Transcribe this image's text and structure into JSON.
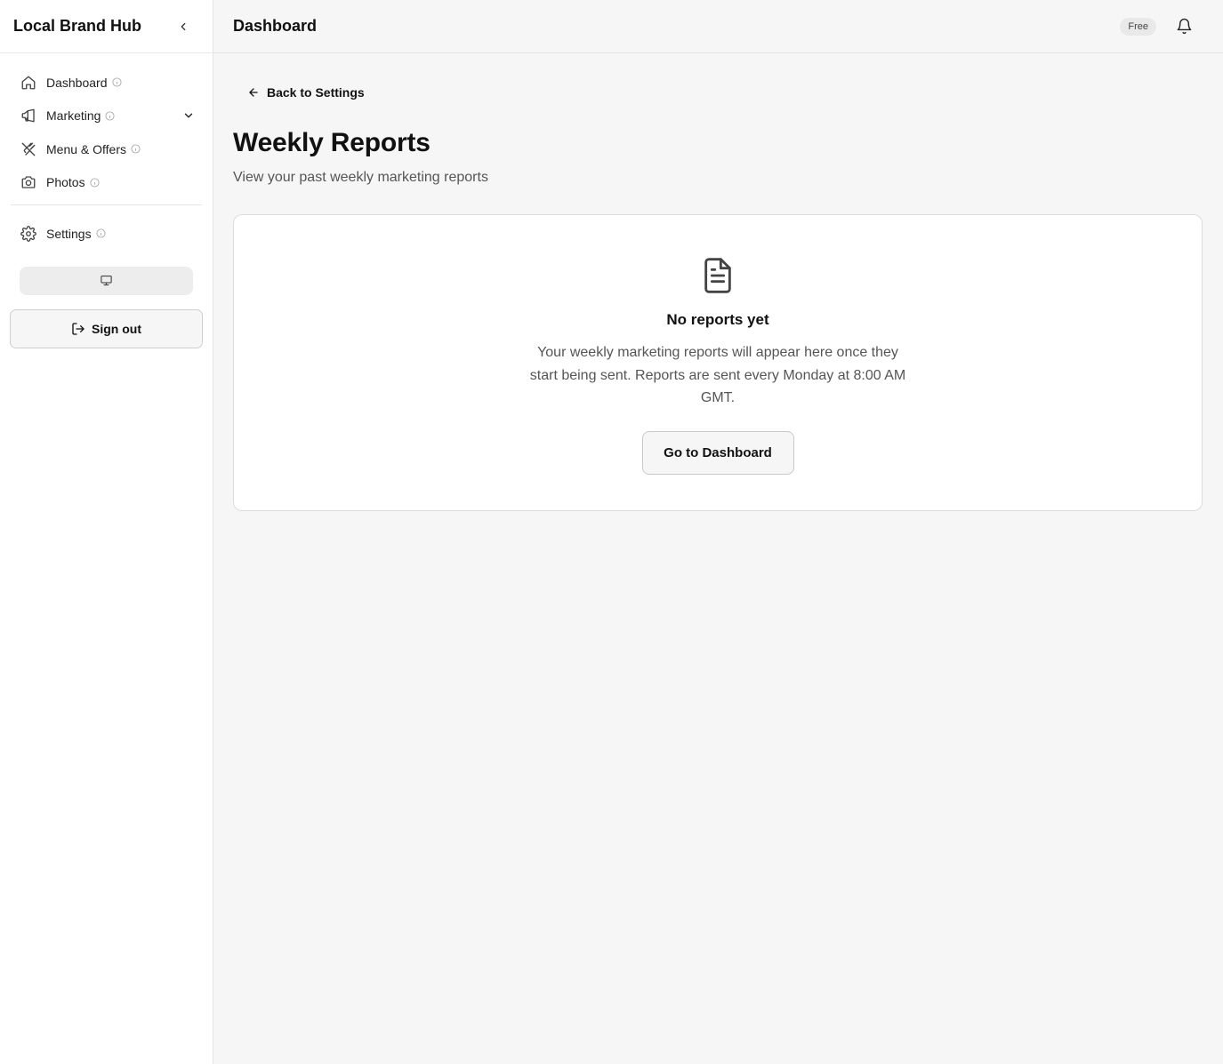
{
  "sidebar": {
    "brand": "Local Brand Hub",
    "items": [
      {
        "label": "Dashboard",
        "icon": "home-icon"
      },
      {
        "label": "Marketing",
        "icon": "megaphone-icon"
      },
      {
        "label": "Menu & Offers",
        "icon": "utensils-icon"
      },
      {
        "label": "Photos",
        "icon": "camera-icon"
      },
      {
        "label": "Settings",
        "icon": "gear-icon"
      }
    ],
    "display_icon": "monitor-icon",
    "signout_label": "Sign out"
  },
  "topbar": {
    "title": "Dashboard",
    "plan_badge": "Free"
  },
  "main": {
    "back_label": "Back to Settings",
    "title": "Weekly Reports",
    "subtitle": "View your past weekly marketing reports",
    "empty_state": {
      "title": "No reports yet",
      "description": "Your weekly marketing reports will appear here once they start being sent. Reports are sent every Monday at 8:00 AM GMT.",
      "button_label": "Go to Dashboard"
    }
  },
  "colors": {
    "background": "#f6f6f6",
    "sidebar": "#ffffff",
    "border": "#dcdcdc",
    "text": "#111111",
    "muted": "#555555"
  }
}
